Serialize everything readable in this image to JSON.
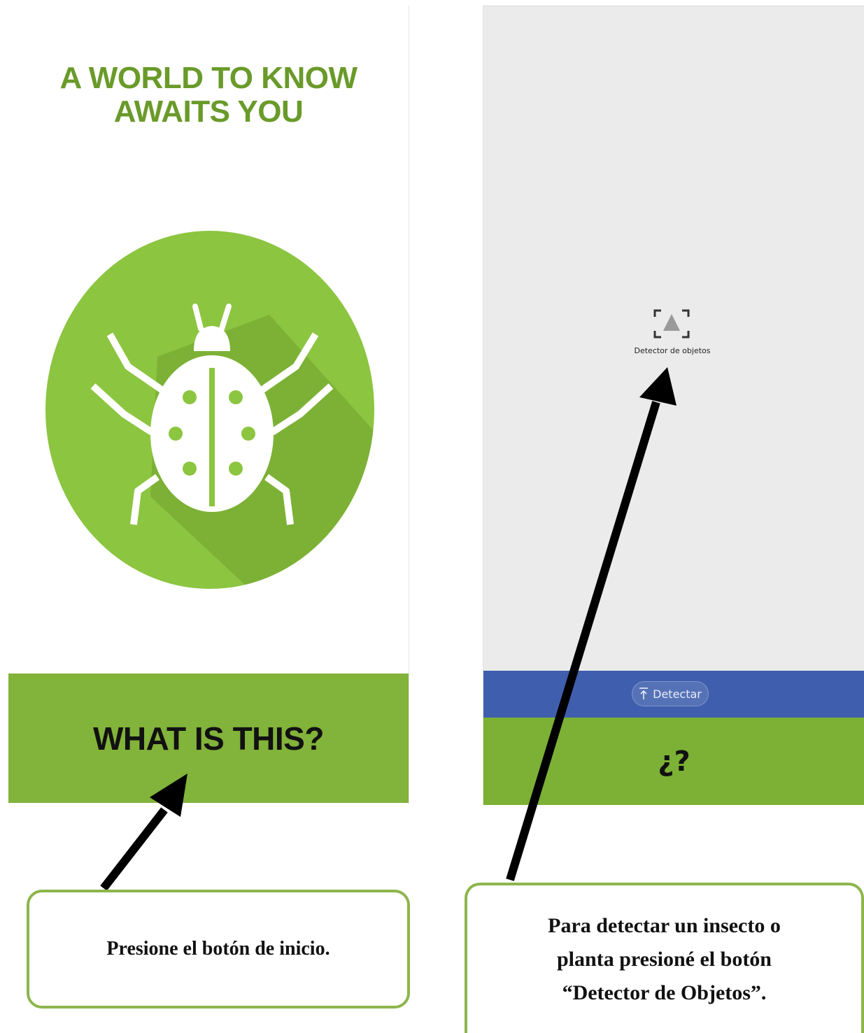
{
  "left_screen": {
    "title_line1": "A WORLD TO KNOW",
    "title_line2": "AWAITS YOU",
    "logo_icon": "ladybug-icon",
    "start_button_label": "WHAT IS THIS?"
  },
  "right_screen": {
    "detector_icon": "object-detection-icon",
    "detector_label": "Detector de objetos",
    "detect_button_label": "Detectar",
    "detect_button_icon": "upload-arrow-icon",
    "help_label": "¿?"
  },
  "callouts": {
    "left": "Presione el botón de inicio.",
    "right_line1": "Para detectar un insecto o",
    "right_line2": "planta presioné el botón",
    "right_line3": "“Detector de Objetos”."
  },
  "colors": {
    "brand_green": "#82b33a",
    "title_green": "#6a9a2a",
    "action_blue": "#3f5fae",
    "callout_border": "#8db54c"
  }
}
